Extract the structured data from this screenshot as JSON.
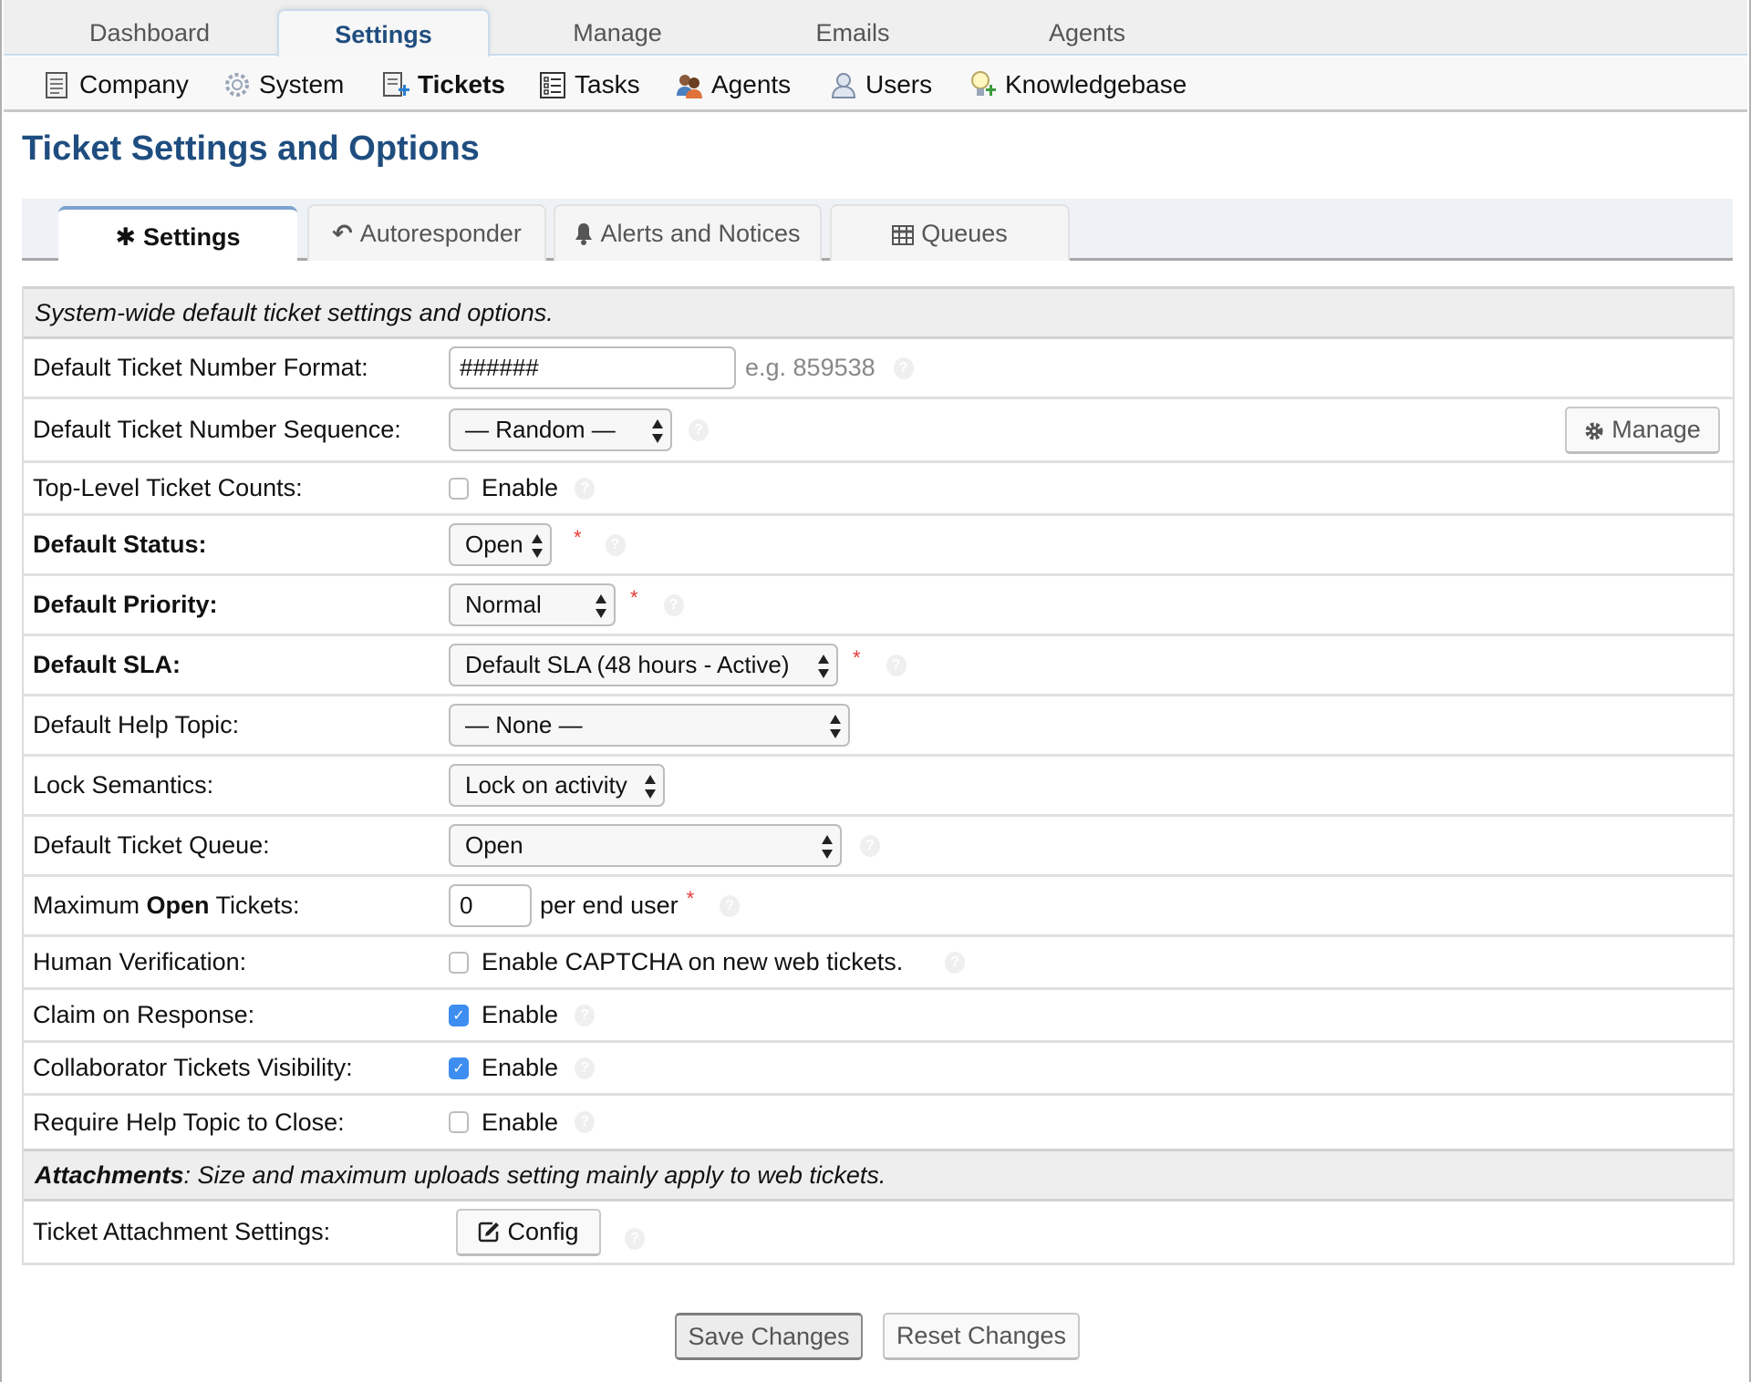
{
  "top_tabs": [
    {
      "label": "Dashboard",
      "active": false
    },
    {
      "label": "Settings",
      "active": true
    },
    {
      "label": "Manage",
      "active": false
    },
    {
      "label": "Emails",
      "active": false
    },
    {
      "label": "Agents",
      "active": false
    }
  ],
  "sub_nav": [
    {
      "label": "Company",
      "icon": "document-icon",
      "active": false
    },
    {
      "label": "System",
      "icon": "gear-icon",
      "active": false
    },
    {
      "label": "Tickets",
      "icon": "ticket-add-icon",
      "active": true
    },
    {
      "label": "Tasks",
      "icon": "checklist-icon",
      "active": false
    },
    {
      "label": "Agents",
      "icon": "agents-icon",
      "active": false
    },
    {
      "label": "Users",
      "icon": "user-icon",
      "active": false
    },
    {
      "label": "Knowledgebase",
      "icon": "lightbulb-icon",
      "active": false
    }
  ],
  "page_title": "Ticket Settings and Options",
  "tabs": [
    {
      "label": "Settings",
      "icon": "asterisk-icon",
      "glyph": "✱",
      "active": true
    },
    {
      "label": "Autoresponder",
      "icon": "reply-all-icon",
      "glyph": "↶",
      "active": false
    },
    {
      "label": "Alerts and Notices",
      "icon": "bell-icon",
      "glyph": "🔔",
      "active": false
    },
    {
      "label": "Queues",
      "icon": "table-icon",
      "glyph": "▦",
      "active": false
    }
  ],
  "section_header": "System-wide default ticket settings and options.",
  "fields": {
    "number_format": {
      "label": "Default Ticket Number Format:",
      "value": "######",
      "hint": "e.g. 859538"
    },
    "number_sequence": {
      "label": "Default Ticket Number Sequence:",
      "value": "— Random —",
      "manage_label": "Manage"
    },
    "top_level_counts": {
      "label": "Top-Level Ticket Counts:",
      "checkbox_label": "Enable",
      "checked": false
    },
    "default_status": {
      "label": "Default Status:",
      "value": "Open",
      "required": "*"
    },
    "default_priority": {
      "label": "Default Priority:",
      "value": "Normal",
      "required": "*"
    },
    "default_sla": {
      "label": "Default SLA:",
      "value": "Default SLA (48 hours - Active)",
      "required": "*"
    },
    "default_help_topic": {
      "label": "Default Help Topic:",
      "value": "— None —"
    },
    "lock_semantics": {
      "label": "Lock Semantics:",
      "value": "Lock on activity"
    },
    "default_queue": {
      "label": "Default Ticket Queue:",
      "value": "Open"
    },
    "max_open": {
      "label_pre": "Maximum ",
      "label_bold": "Open",
      "label_post": " Tickets:",
      "value": "0",
      "suffix": "per end user",
      "required": "*"
    },
    "human_verification": {
      "label": "Human Verification:",
      "checkbox_label": "Enable CAPTCHA on new web tickets.",
      "checked": false
    },
    "claim_on_response": {
      "label": "Claim on Response:",
      "checkbox_label": "Enable",
      "checked": true
    },
    "collaborator_visibility": {
      "label": "Collaborator Tickets Visibility:",
      "checkbox_label": "Enable",
      "checked": true
    },
    "require_help_topic": {
      "label": "Require Help Topic to Close:",
      "checkbox_label": "Enable",
      "checked": false
    }
  },
  "attachments_header": {
    "bold": "Attachments",
    "text": ": Size and maximum uploads setting mainly apply to web tickets."
  },
  "attachment_settings": {
    "label": "Ticket Attachment Settings:",
    "button_label": "Config"
  },
  "footer": {
    "save_label": "Save Changes",
    "reset_label": "Reset Changes"
  },
  "colors": {
    "accent": "#1f4d7f",
    "checkbox_checked": "#3d8ef0",
    "required": "#e53935"
  }
}
